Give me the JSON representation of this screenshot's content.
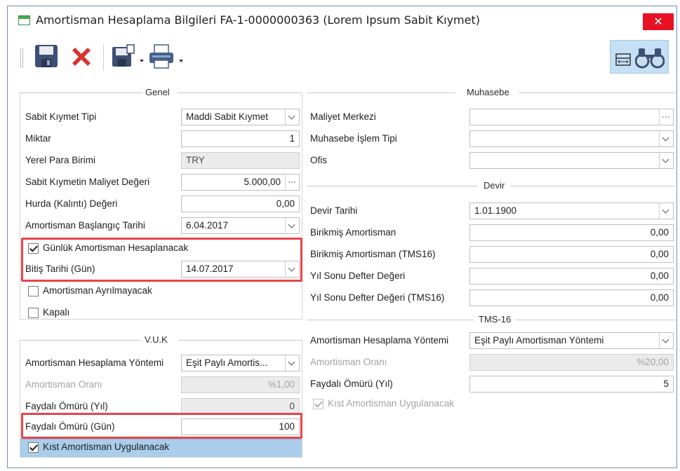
{
  "window": {
    "title": "Amortisman Hesaplama Bilgileri FA-1-0000000363 (Lorem Ipsum Sabit Kıymet)",
    "close_label": "✕"
  },
  "toolbar": {
    "icons": [
      "save-icon",
      "delete-icon",
      "save-as-icon",
      "print-icon",
      "layout-icon",
      "find-icon"
    ],
    "accent_color": "#c5dff5"
  },
  "genel": {
    "title": "Genel",
    "sabit_kiymet_tipi": {
      "label": "Sabit Kıymet Tipi",
      "value": "Maddi Sabit Kıymet"
    },
    "miktar": {
      "label": "Miktar",
      "value": "1"
    },
    "yerel_para_birimi": {
      "label": "Yerel Para Birimi",
      "value": "TRY"
    },
    "maliyet_degeri": {
      "label": "Sabit Kıymetin Maliyet Değeri",
      "value": "5.000,00"
    },
    "hurda_degeri": {
      "label": "Hurda (Kalıntı) Değeri",
      "value": "0,00"
    },
    "baslangic_tarihi": {
      "label": "Amortisman Başlangıç Tarihi",
      "value": "6.04.2017"
    },
    "gunluk_amortisman": {
      "label": "Günlük Amortisman Hesaplanacak",
      "checked": true
    },
    "bitis_tarihi": {
      "label": "Bitiş Tarihi (Gün)",
      "value": "14.07.2017"
    },
    "amortisman_ayrilmayacak": {
      "label": "Amortisman Ayrılmayacak",
      "checked": false
    },
    "kapali": {
      "label": "Kapalı",
      "checked": false
    }
  },
  "vuk": {
    "title": "V.U.K",
    "hesaplama_yontemi": {
      "label": "Amortisman Hesaplama Yöntemi",
      "value": "Eşit Paylı Amortis..."
    },
    "amortisman_orani": {
      "label": "Amortisman Oranı",
      "value": "%1,00"
    },
    "faydali_omru_yil": {
      "label": "Faydalı Ömürü (Yıl)",
      "value": "0"
    },
    "faydali_omru_gun": {
      "label": "Faydalı Ömürü (Gün)",
      "value": "100"
    },
    "kist_amortisman": {
      "label": "Kıst Amortisman Uygulanacak",
      "checked": true
    }
  },
  "muhasebe": {
    "title": "Muhasebe",
    "maliyet_merkezi": {
      "label": "Maliyet Merkezi",
      "value": ""
    },
    "islem_tipi": {
      "label": "Muhasebe İşlem Tipi",
      "value": ""
    },
    "ofis": {
      "label": "Ofis",
      "value": ""
    }
  },
  "devir": {
    "title": "Devir",
    "devir_tarihi": {
      "label": "Devir Tarihi",
      "value": "1.01.1900"
    },
    "birikmis_amortisman": {
      "label": "Birikmiş Amortisman",
      "value": "0,00"
    },
    "birikmis_amortisman_tms16": {
      "label": "Birikmiş Amortisman (TMS16)",
      "value": "0,00"
    },
    "yil_sonu_defter_degeri": {
      "label": "Yıl Sonu Defter Değeri",
      "value": "0,00"
    },
    "yil_sonu_defter_degeri_tms16": {
      "label": "Yıl Sonu Defter Değeri (TMS16)",
      "value": "0,00"
    }
  },
  "tms16": {
    "title": "TMS-16",
    "hesaplama_yontemi": {
      "label": "Amortisman Hesaplama Yöntemi",
      "value": "Eşit Paylı Amortisman Yöntemi"
    },
    "amortisman_orani": {
      "label": "Amortisman Oranı",
      "value": "%20,00"
    },
    "faydali_omru_yil": {
      "label": "Faydalı Ömürü (Yıl)",
      "value": "5"
    },
    "kist_amortisman": {
      "label": "Kıst Amortisman Uygulanacak",
      "checked": true
    }
  },
  "highlight_color": "#e8444a"
}
